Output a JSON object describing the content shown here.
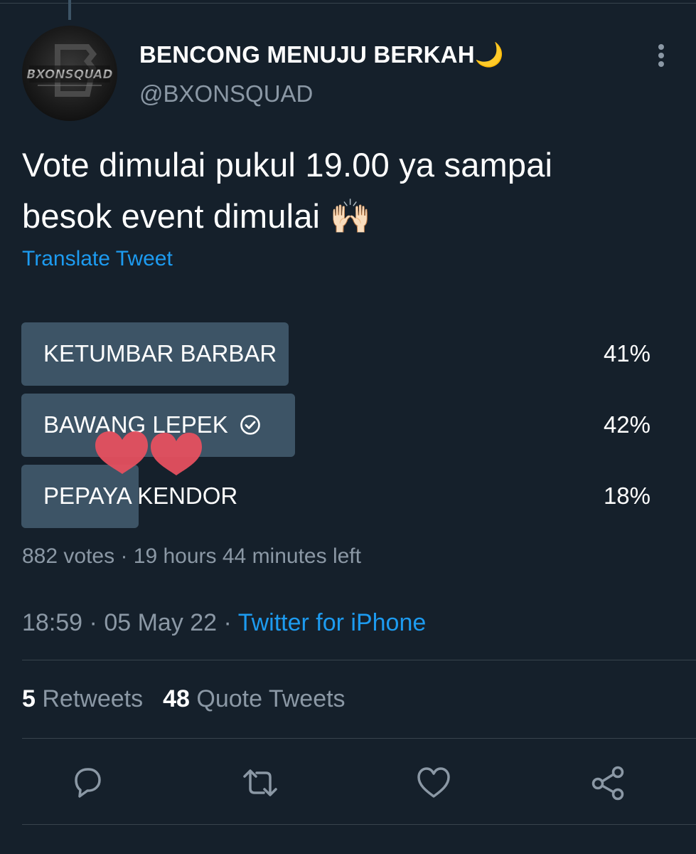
{
  "tweet": {
    "display_name": "BENCONG MENUJU BERKAH",
    "name_emoji": "🌙",
    "handle": "@BXONSQUAD",
    "avatar_text": "BXONSQUAD",
    "text_line1": "Vote dimulai pukul 19.00 ya sampai",
    "text_line2": "besok event dimulai",
    "text_emoji": "🙌🏻",
    "translate_label": "Translate Tweet"
  },
  "poll": {
    "options": [
      {
        "label": "KETUMBAR BARBAR",
        "percent_text": "41%",
        "percent": 41,
        "selected": false
      },
      {
        "label": "BAWANG LEPEK",
        "percent_text": "42%",
        "percent": 42,
        "selected": true
      },
      {
        "label": "PEPAYA KENDOR",
        "percent_text": "18%",
        "percent": 18,
        "selected": false
      }
    ],
    "votes": "882 votes",
    "separator": "·",
    "time_left": "19 hours 44 minutes left"
  },
  "meta": {
    "time": "18:59",
    "date": "05 May 22",
    "separator": "·",
    "source": "Twitter for iPhone"
  },
  "stats": {
    "retweets_count": "5",
    "retweets_label": "Retweets",
    "quotes_count": "48",
    "quotes_label": "Quote Tweets"
  },
  "icons": {
    "more": "more-vertical-icon",
    "reply": "reply-icon",
    "retweet": "retweet-icon",
    "like": "heart-icon",
    "share": "share-icon",
    "check": "check-circle-icon"
  },
  "colors": {
    "background": "#15202b",
    "bar": "#3d5466",
    "accent": "#1d9bf0",
    "muted": "#8b98a5",
    "divider": "#38444d",
    "heart_sticker": "#e5505f"
  }
}
